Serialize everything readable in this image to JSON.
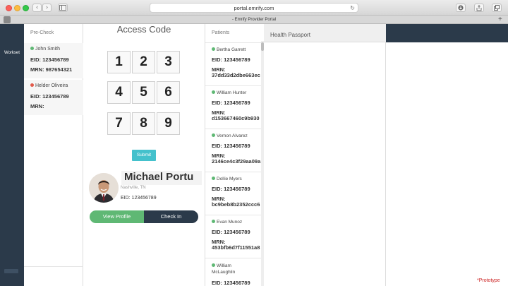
{
  "browser": {
    "url": "portal.emrify.com",
    "tab_title": "- Emrify Provider Portal",
    "back_glyph": "‹",
    "forward_glyph": "›",
    "reload_glyph": "↻",
    "new_tab_glyph": "+"
  },
  "leftnav": {
    "workset_label": "Workset"
  },
  "precheck": {
    "title": "Pre-Check",
    "items": [
      {
        "name": "John Smith",
        "status_color": "#5fb874",
        "eid": "EID: 123456789",
        "mrn": "MRN: 987654321"
      },
      {
        "name": "Helder Oliveira",
        "status_color": "#e25b4b",
        "eid": "EID: 123456789",
        "mrn": "MRN:"
      }
    ]
  },
  "access": {
    "title": "Access Code",
    "keys": [
      "1",
      "2",
      "3",
      "4",
      "5",
      "6",
      "7",
      "8",
      "9"
    ],
    "submit_label": "Submit"
  },
  "profile": {
    "name": "Michael Portu",
    "location": "Nashville, TN",
    "eid": "EID: 123456789",
    "view_label": "View Profile",
    "checkin_label": "Check In"
  },
  "patients": {
    "title": "Patients",
    "items": [
      {
        "name": "Bertha Garrett",
        "eid": "EID: 123456789",
        "mrn_label": "MRN:",
        "mrn": "37dd33d2dbe663ec"
      },
      {
        "name": "William Hunter",
        "eid": "EID: 123456789",
        "mrn_label": "MRN:",
        "mrn": "d153667460c9b930"
      },
      {
        "name": "Vernon Alvarez",
        "eid": "EID: 123456789",
        "mrn_label": "MRN:",
        "mrn": "2146ce4c3f29aa09a"
      },
      {
        "name": "Dollie Myers",
        "eid": "EID: 123456789",
        "mrn_label": "MRN:",
        "mrn": "bc9beb8b2352ccc6"
      },
      {
        "name": "Evan Munoz",
        "eid": "EID: 123456789",
        "mrn_label": "MRN:",
        "mrn": "453bfb6d7f11551a8"
      },
      {
        "name": "William McLaughlin",
        "eid": "EID: 123456789",
        "mrn_label": "",
        "mrn": ""
      }
    ]
  },
  "passport": {
    "title": "Health Passport"
  },
  "footer": {
    "prototype_label": "*Prototype"
  }
}
